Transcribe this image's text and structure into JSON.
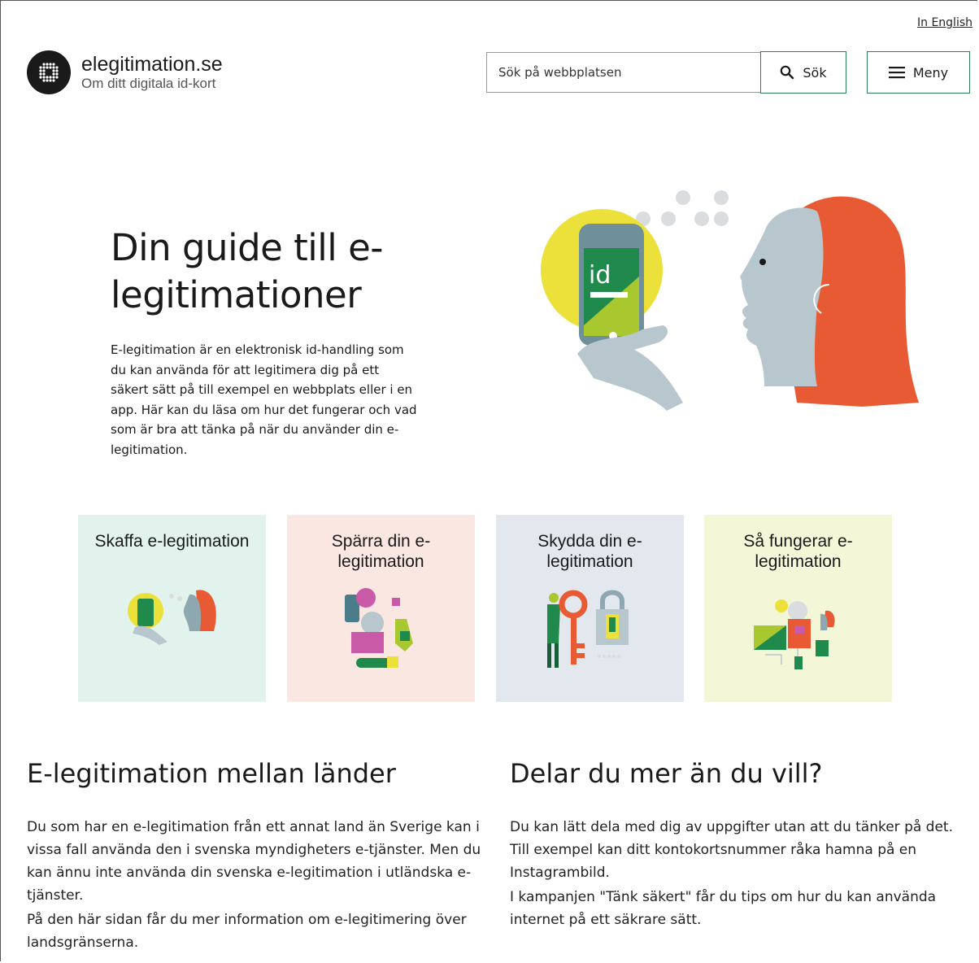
{
  "header": {
    "language_link": "In English",
    "logo_title": "elegitimation.se",
    "logo_subtitle": "Om ditt digitala id-kort",
    "search_placeholder": "Sök på webbplatsen",
    "search_button": "Sök",
    "menu_button": "Meny"
  },
  "hero": {
    "title": "Din guide till e-legitimationer",
    "text": "E-legitimation är en elektronisk id-handling som du kan använda för att legitimera dig på ett säkert sätt på till exempel en webbplats eller i en app. Här kan du läsa om hur det fungerar och vad som är bra att tänka på när du använder din e-legitimation.",
    "illustration_id_text": "id"
  },
  "cards": [
    {
      "title": "Skaffa e-legitimation",
      "bg": "#e2f3ee"
    },
    {
      "title": "Spärra din e-legitimation",
      "bg": "#fbe7e2"
    },
    {
      "title": "Skydda din e-legitimation",
      "bg": "#e3e8ef"
    },
    {
      "title": "Så fungerar e-legitimation",
      "bg": "#f4f6d8"
    }
  ],
  "sections": [
    {
      "heading": "E-legitimation mellan länder",
      "paragraphs": [
        "Du som har en e-legitimation från ett annat land än Sverige kan i vissa fall använda den i svenska myndigheters e-tjänster. Men du kan ännu inte använda din svenska e-legitimation i utländska e-tjänster.",
        "På den här sidan får du mer information om e-legitimering över landsgränserna."
      ]
    },
    {
      "heading": "Delar du mer än du vill?",
      "paragraphs": [
        "Du kan lätt dela med dig av uppgifter utan att du tänker på det. Till exempel kan ditt kontokortsnummer råka hamna på en Instagrambild.",
        "I kampanjen \"Tänk säkert\" får du tips om hur du kan använda internet på ett säkrare sätt."
      ]
    }
  ],
  "colors": {
    "accent_green": "#2e7d55",
    "hero_yellow": "#ece13a",
    "hero_red": "#e85a33",
    "hero_grey_blue": "#b7c7cd"
  }
}
